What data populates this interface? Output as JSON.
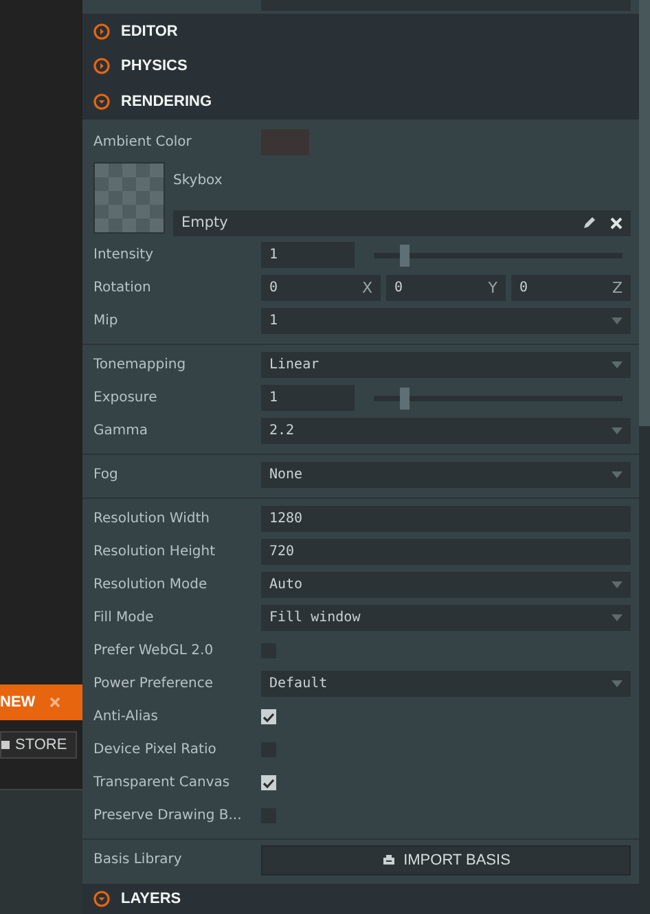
{
  "left_panel": {
    "new_button": "NEW",
    "store_button": "STORE"
  },
  "headers": [
    {
      "label": "EDITOR",
      "expanded": false
    },
    {
      "label": "PHYSICS",
      "expanded": false
    },
    {
      "label": "RENDERING",
      "expanded": true
    }
  ],
  "rendering_groups": [
    [
      {
        "kind": "color",
        "label": "Ambient Color",
        "color": "#3b3434"
      },
      {
        "kind": "skybox",
        "label": "Skybox",
        "value": "Empty"
      },
      {
        "kind": "slider",
        "label": "Intensity",
        "value": "1",
        "level": 0.11
      },
      {
        "kind": "vector",
        "label": "Rotation",
        "values": [
          {
            "value": "0",
            "axis": "X"
          },
          {
            "value": "0",
            "axis": "Y"
          },
          {
            "value": "0",
            "axis": "Z"
          }
        ]
      },
      {
        "kind": "select",
        "label": "Mip",
        "value": "1"
      }
    ],
    [
      {
        "kind": "select",
        "label": "Tonemapping",
        "value": "Linear"
      },
      {
        "kind": "slider",
        "label": "Exposure",
        "value": "1",
        "level": 0.11
      },
      {
        "kind": "select",
        "label": "Gamma",
        "value": "2.2"
      }
    ],
    [
      {
        "kind": "select",
        "label": "Fog",
        "value": "None"
      }
    ],
    [
      {
        "kind": "text",
        "label": "Resolution Width",
        "value": "1280"
      },
      {
        "kind": "text",
        "label": "Resolution Height",
        "value": "720"
      },
      {
        "kind": "select",
        "label": "Resolution Mode",
        "value": "Auto"
      },
      {
        "kind": "select",
        "label": "Fill Mode",
        "value": "Fill window"
      },
      {
        "kind": "checkbox",
        "label": "Prefer WebGL 2.0",
        "checked": false
      },
      {
        "kind": "select",
        "label": "Power Preference",
        "value": "Default"
      },
      {
        "kind": "checkbox",
        "label": "Anti-Alias",
        "checked": true
      },
      {
        "kind": "checkbox",
        "label": "Device Pixel Ratio",
        "checked": false
      },
      {
        "kind": "checkbox",
        "label": "Transparent Canvas",
        "checked": true
      },
      {
        "kind": "checkbox",
        "label": "Preserve Drawing B...",
        "checked": false
      }
    ],
    [
      {
        "kind": "button",
        "label": "Basis Library",
        "value": "IMPORT BASIS"
      }
    ]
  ],
  "footer_header": {
    "label": "LAYERS",
    "expanded": true
  }
}
